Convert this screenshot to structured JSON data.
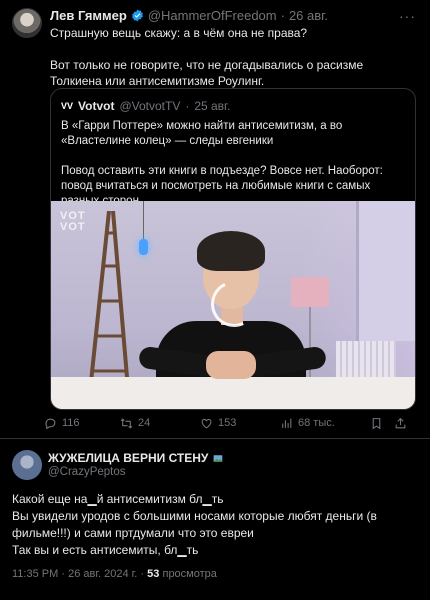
{
  "tweet": {
    "author_name": "Лев Гяммер",
    "handle": "@HammerOfFreedom",
    "separator": "·",
    "date": "26 авг.",
    "more_label": "···",
    "paragraph1": "Страшную вещь скажу: а в чём она не права?",
    "paragraph2": "Вот только не говорите, что не догадывались о расизме Толкиена или антисемитизме Роулинг."
  },
  "quote": {
    "logo": "VV",
    "author_name": "Votvot",
    "handle": "@VotvotTV",
    "separator": "·",
    "date": "25 авг.",
    "paragraph1": "В «Гарри Поттере» можно найти антисемитизм, а во «Властелине колец» — следы евгеники",
    "paragraph2": "Повод оставить эти книги в подъезде? Вовсе нет. Наоборот: повод вчитаться и посмотреть на любимые книги с самых разных сторон.",
    "watermark": "VOT\nVOT"
  },
  "actions": {
    "replies": "116",
    "reposts": "24",
    "likes": "153",
    "views": "68 тыс."
  },
  "reply": {
    "author_name": "ЖУЖЕЛИЦА ВЕРНИ СТЕНУ",
    "handle": "@CrazyPeptos",
    "line1": "Какой еще на▁й антисемитизм бл▁ть",
    "line2": "Вы увидели уродов с большими носами которые любят деньги (в фильме!!!) и сами пртдумали что это евреи",
    "line3": "Так вы и есть антисемиты, бл▁ть",
    "time": "11:35 PM",
    "separator": "·",
    "date": "26 авг. 2024 г.",
    "separator2": "·",
    "views_count": "53",
    "views_label": "просмотра"
  },
  "colors": {
    "background": "#000000",
    "text": "#e7e9ea",
    "muted": "#71767b",
    "verified": "#1d9bf0",
    "border": "#2f3336"
  }
}
